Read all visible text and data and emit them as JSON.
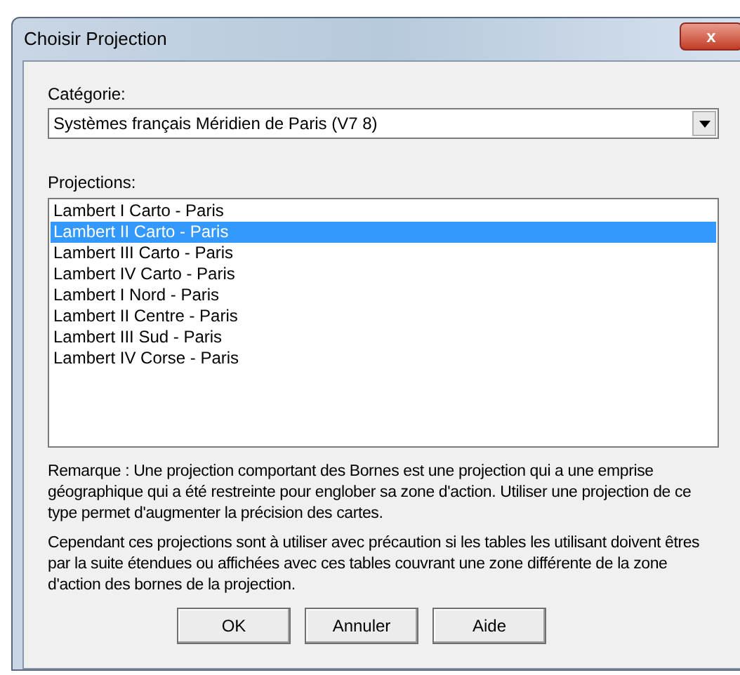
{
  "window": {
    "title": "Choisir Projection",
    "close_label": "x"
  },
  "category": {
    "label": "Catégorie:",
    "value": "Systèmes français Méridien de Paris (V7 8)"
  },
  "projections": {
    "label": "Projections:",
    "items": [
      {
        "text": "Lambert I Carto - Paris",
        "selected": false
      },
      {
        "text": "Lambert II Carto - Paris",
        "selected": true
      },
      {
        "text": "Lambert III Carto - Paris",
        "selected": false
      },
      {
        "text": "Lambert IV Carto - Paris",
        "selected": false
      },
      {
        "text": "Lambert I Nord - Paris",
        "selected": false
      },
      {
        "text": "Lambert II Centre - Paris",
        "selected": false
      },
      {
        "text": "Lambert III Sud - Paris",
        "selected": false
      },
      {
        "text": "Lambert IV Corse - Paris",
        "selected": false
      }
    ]
  },
  "notes": [
    "Remarque : Une projection comportant des Bornes est une projection qui a une emprise géographique qui a été restreinte pour englober sa zone d'action. Utiliser une projection de ce type permet d'augmenter la précision des cartes.",
    "Cependant ces projections sont à utiliser avec précaution si les tables les utilisant doivent êtres par la suite étendues ou affichées avec ces tables couvrant une zone différente de la zone d'action des bornes de la projection."
  ],
  "buttons": [
    "OK",
    "Annuler",
    "Aide"
  ]
}
